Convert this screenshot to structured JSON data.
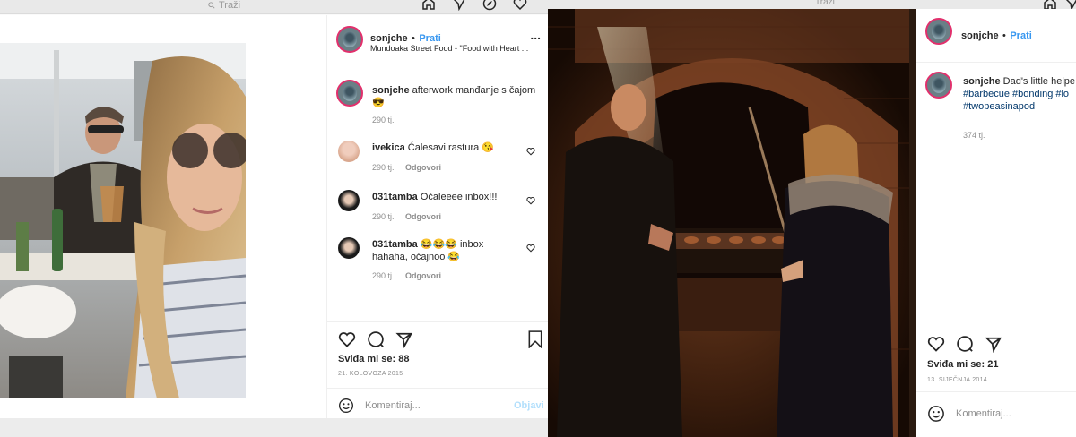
{
  "left": {
    "search_placeholder": "Traži",
    "post": {
      "username": "sonjche",
      "follow_separator": "•",
      "follow_label": "Prati",
      "location": "Mundoaka Street Food - \"Food with Heart ...",
      "more_label": "...",
      "caption_user": "sonjche",
      "caption_text": "afterwork manđanje s čajom 😎",
      "caption_time": "290 tj.",
      "comments": [
        {
          "user": "ivekica",
          "text": "Ćalesavi rastura 😘",
          "time": "290 tj.",
          "reply": "Odgovori"
        },
        {
          "user": "031tamba",
          "text": "Očaleeee inbox!!!",
          "time": "290 tj.",
          "reply": "Odgovori"
        },
        {
          "user": "031tamba",
          "text": "😂😂😂 inbox",
          "text2": "hahaha, očajnoo 😂",
          "time": "290 tj.",
          "reply": "Odgovori"
        }
      ],
      "likes": "Sviđa mi se: 88",
      "date": "21. KOLOVOZA 2015",
      "comment_placeholder": "Komentiraj...",
      "post_button": "Objavi"
    }
  },
  "right": {
    "search_placeholder": "Traži",
    "post": {
      "username": "sonjche",
      "follow_separator": "•",
      "follow_label": "Prati",
      "caption_user": "sonjche",
      "caption_text": "Dad's little helpe",
      "hashtags_line1": "#barbecue #bonding #lo",
      "hashtags_line2": "#twopeasinapod",
      "caption_time": "374 tj.",
      "likes": "Sviđa mi se: 21",
      "date": "13. SIJEČNJA 2014",
      "comment_placeholder": "Komentiraj..."
    }
  },
  "colors": {
    "link_blue": "#3897f0",
    "story_ring": "#e1306c",
    "muted": "#8e8e8e"
  }
}
